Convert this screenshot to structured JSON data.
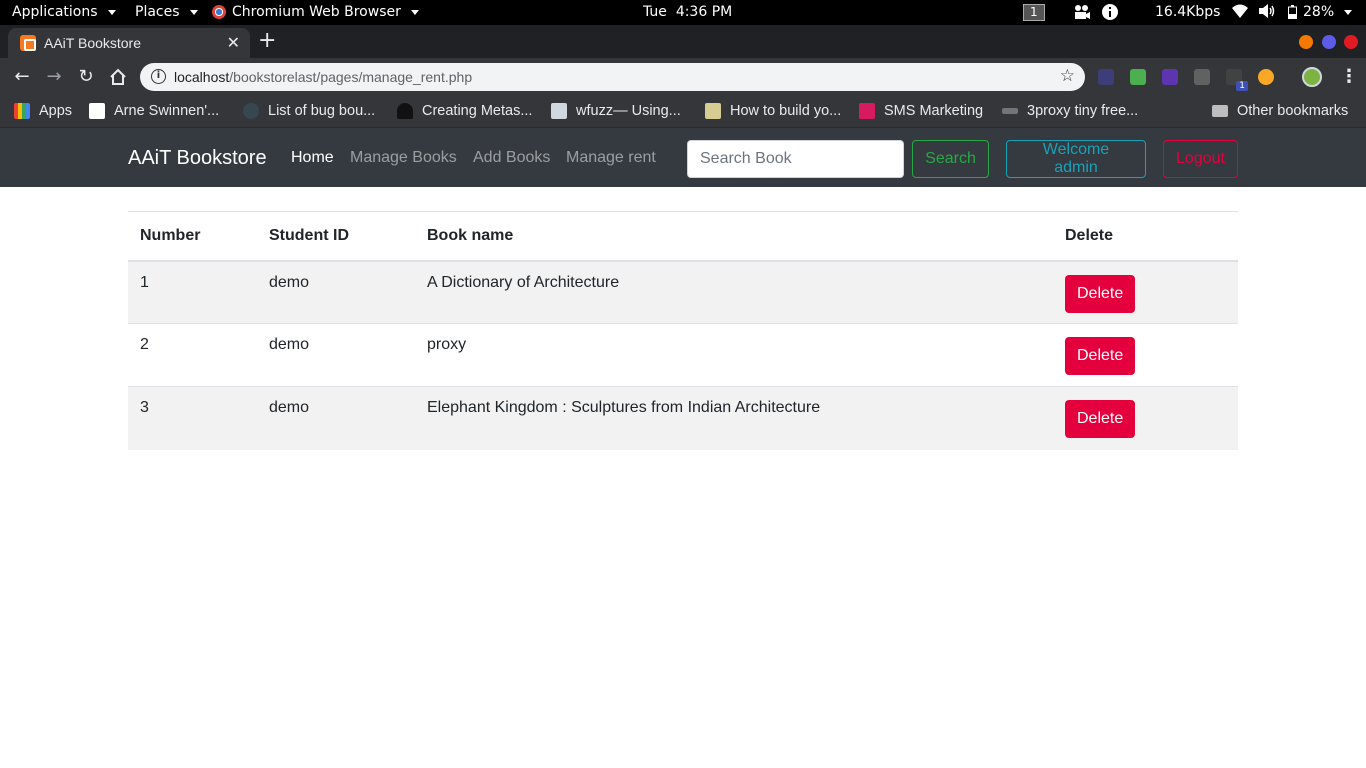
{
  "system_bar": {
    "applications": "Applications",
    "places": "Places",
    "browser": "Chromium Web Browser",
    "clock": "Tue  4:36 PM",
    "workspace": "1",
    "net_speed": "16.4Kbps",
    "battery": "28%"
  },
  "browser": {
    "tab_title": "AAiT Bookstore",
    "url_host": "localhost",
    "url_path": "/bookstorelast/pages/manage_rent.php",
    "extension_badge": "1",
    "bookmarks": [
      "Apps",
      "Arne Swinnen'...",
      "List of bug bou...",
      "Creating Metas...",
      "wfuzz— Using...",
      "How to build yo...",
      "SMS Marketing",
      "3proxy tiny free...",
      "Other bookmarks"
    ]
  },
  "navbar": {
    "brand": "AAiT Bookstore",
    "links": [
      "Home",
      "Manage Books",
      "Add Books",
      "Manage rent"
    ],
    "search_placeholder": "Search Book",
    "search_button": "Search",
    "welcome": "Welcome admin",
    "logout": "Logout"
  },
  "table": {
    "headers": [
      "Number",
      "Student ID",
      "Book name",
      "Delete"
    ],
    "rows": [
      {
        "number": "1",
        "student_id": "demo",
        "book": "A Dictionary of Architecture",
        "action": "Delete"
      },
      {
        "number": "2",
        "student_id": "demo",
        "book": "proxy",
        "action": "Delete"
      },
      {
        "number": "3",
        "student_id": "demo",
        "book": "Elephant Kingdom : Sculptures from Indian Architecture",
        "action": "Delete"
      }
    ]
  },
  "colors": {
    "navbar_bg": "#343a40",
    "success": "#28a745",
    "info": "#17a2b8",
    "danger": "#e4003d"
  }
}
